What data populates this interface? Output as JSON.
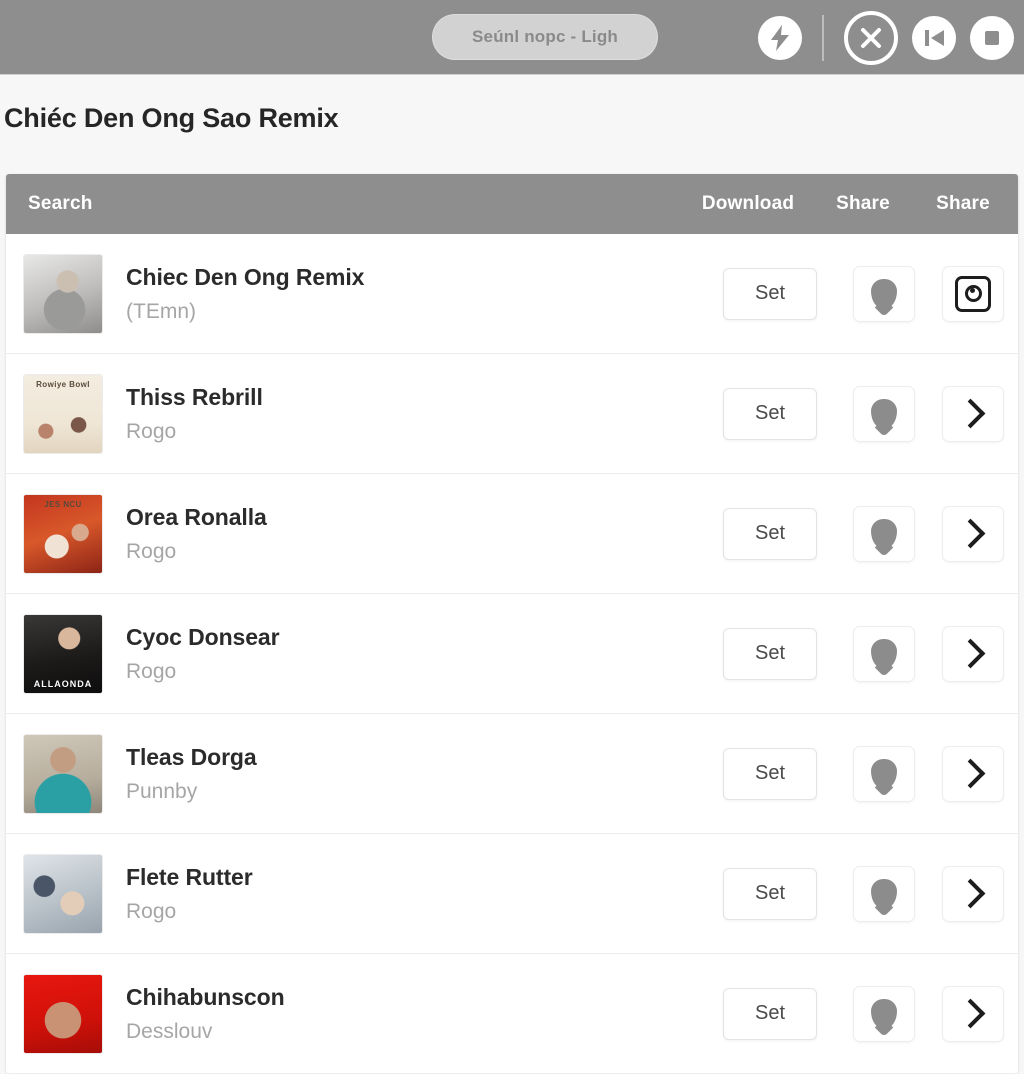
{
  "topbar": {
    "search_pill_text": "Seúnl nopc - Ligh",
    "actions": [
      {
        "name": "lightning-bolt-icon",
        "label": "Flash"
      },
      {
        "name": "close-circle-icon",
        "label": "Close"
      },
      {
        "name": "previous-track-icon",
        "label": "Previous"
      },
      {
        "name": "stop-icon",
        "label": "Stop"
      }
    ]
  },
  "page": {
    "title": "Chiéc Den Ong Sao Remix"
  },
  "table": {
    "headers": {
      "search": "Search",
      "download": "Download",
      "share_1": "Share",
      "share_2": "Share"
    },
    "set_label": "Set",
    "rows": [
      {
        "title": "Chiec Den Ong Remix",
        "subtitle": "(TEmn)",
        "art": "art-gray",
        "art_top": "",
        "art_label": "",
        "action_icon": "record-box-icon"
      },
      {
        "title": "Thiss Rebrill",
        "subtitle": "Rogo",
        "art": "art-cream",
        "art_top": "Rowiye Bowl",
        "art_label": "",
        "action_icon": "chevron-right-icon"
      },
      {
        "title": "Orea Ronalla",
        "subtitle": "Rogo",
        "art": "art-red",
        "art_top": "JES NCU",
        "art_label": "",
        "action_icon": "chevron-right-icon"
      },
      {
        "title": "Cyoc Donsear",
        "subtitle": "Rogo",
        "art": "art-dark",
        "art_top": "",
        "art_label": "ALLAONDA",
        "action_icon": "chevron-right-icon"
      },
      {
        "title": "Tleas Dorga",
        "subtitle": "Punnby",
        "art": "art-teal",
        "art_top": "",
        "art_label": "",
        "action_icon": "chevron-right-icon"
      },
      {
        "title": "Flete Rutter",
        "subtitle": "Rogo",
        "art": "art-blue",
        "art_top": "",
        "art_label": "",
        "action_icon": "chevron-right-icon"
      },
      {
        "title": "Chihabunscon",
        "subtitle": "Desslouv",
        "art": "art-scarlet",
        "art_top": "",
        "art_label": "",
        "action_icon": "chevron-right-icon"
      }
    ]
  },
  "colors": {
    "topbar_gray": "#8e8e8e",
    "page_bg": "#f7f7f7",
    "card_bg": "#ffffff",
    "title_text": "#262626",
    "subtitle_text": "#a6a6a6",
    "pin_gray": "#8c8c8c"
  }
}
